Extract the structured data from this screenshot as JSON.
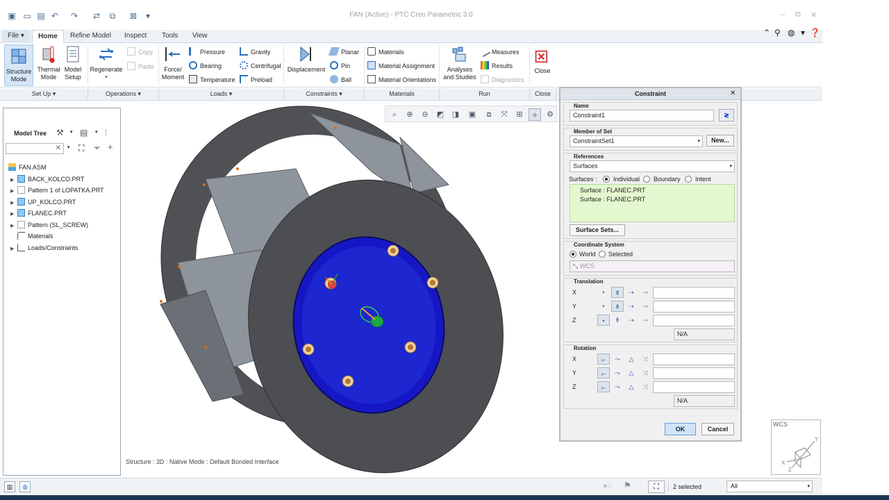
{
  "window": {
    "title": "FAN (Active) - PTC Creo Parametric 3.0"
  },
  "tabs": [
    {
      "label": "File ▾"
    },
    {
      "label": "Home"
    },
    {
      "label": "Refine Model"
    },
    {
      "label": "Inspect"
    },
    {
      "label": "Tools"
    },
    {
      "label": "View"
    }
  ],
  "ribbon": {
    "setup": {
      "structure": "Structure\nMode",
      "thermal": "Thermal\nMode",
      "model": "Model\nSetup",
      "group": "Set Up ▾"
    },
    "operations": {
      "regenerate": "Regenerate",
      "copy": "Copy",
      "paste": "Paste",
      "group": "Operations ▾"
    },
    "loads": {
      "force": "Force/\nMoment",
      "pressure": "Pressure",
      "bearing": "Bearing",
      "temperature": "Temperature",
      "gravity": "Gravity",
      "centrifugal": "Centrifugal",
      "preload": "Preload",
      "group": "Loads ▾"
    },
    "constraints": {
      "displacement": "Displacement",
      "planar": "Planar",
      "pin": "Pin",
      "ball": "Ball",
      "group": "Constraints ▾"
    },
    "materials": {
      "materials": "Materials",
      "assignment": "Material Assignment",
      "orientations": "Material Orientations",
      "group": "Materials"
    },
    "run": {
      "analyses": "Analyses\nand Studies",
      "measures": "Measures",
      "results": "Results",
      "diagnostics": "Diagnostics",
      "group": "Run"
    },
    "close": {
      "label": "Close",
      "group": "Close"
    }
  },
  "model_tree": {
    "title": "Model Tree",
    "items": [
      {
        "label": "FAN.ASM",
        "expandable": false
      },
      {
        "label": "BACK_KOLCO.PRT",
        "expandable": true
      },
      {
        "label": "Pattern 1 of LOPATKA.PRT",
        "expandable": true
      },
      {
        "label": "UP_KOLCO.PRT",
        "expandable": true
      },
      {
        "label": "FLANEC.PRT",
        "expandable": true
      },
      {
        "label": "Pattern (SL_SCREW)",
        "expandable": true
      },
      {
        "label": "Materials",
        "expandable": false
      },
      {
        "label": "Loads/Constraints",
        "expandable": true
      }
    ]
  },
  "graphics": {
    "status": "Structure : 3D : Native Mode : Default Bonded Interface",
    "wcs": "WCS"
  },
  "dialog": {
    "title": "Constraint",
    "name_label": "Name",
    "name_value": "Constraint1",
    "set_label": "Member of Set",
    "set_value": "ConstraintSet1",
    "new_button": "New...",
    "references_label": "References",
    "references_value": "Surfaces",
    "surfaces_label": "Surfaces :",
    "mode_options": [
      "Individual",
      "Boundary",
      "Intent"
    ],
    "mode_selected": "Individual",
    "selected_refs": [
      "Surface : FLANEC.PRT",
      "Surface : FLANEC.PRT"
    ],
    "surface_sets_button": "Surface Sets...",
    "csys_label": "Coordinate System",
    "csys_options": [
      "World",
      "Selected"
    ],
    "csys_selected": "World",
    "csys_field": "WCS",
    "translation_label": "Translation",
    "rotation_label": "Rotation",
    "axes": [
      "X",
      "Y",
      "Z"
    ],
    "na": "N/A",
    "ok": "OK",
    "cancel": "Cancel"
  },
  "statusbar": {
    "selected": "2 selected",
    "filter": "All"
  },
  "colors": {
    "accent": "#2f7bd8",
    "constraint_blue": "#1a1ab8",
    "fan_gray": "#505256"
  }
}
